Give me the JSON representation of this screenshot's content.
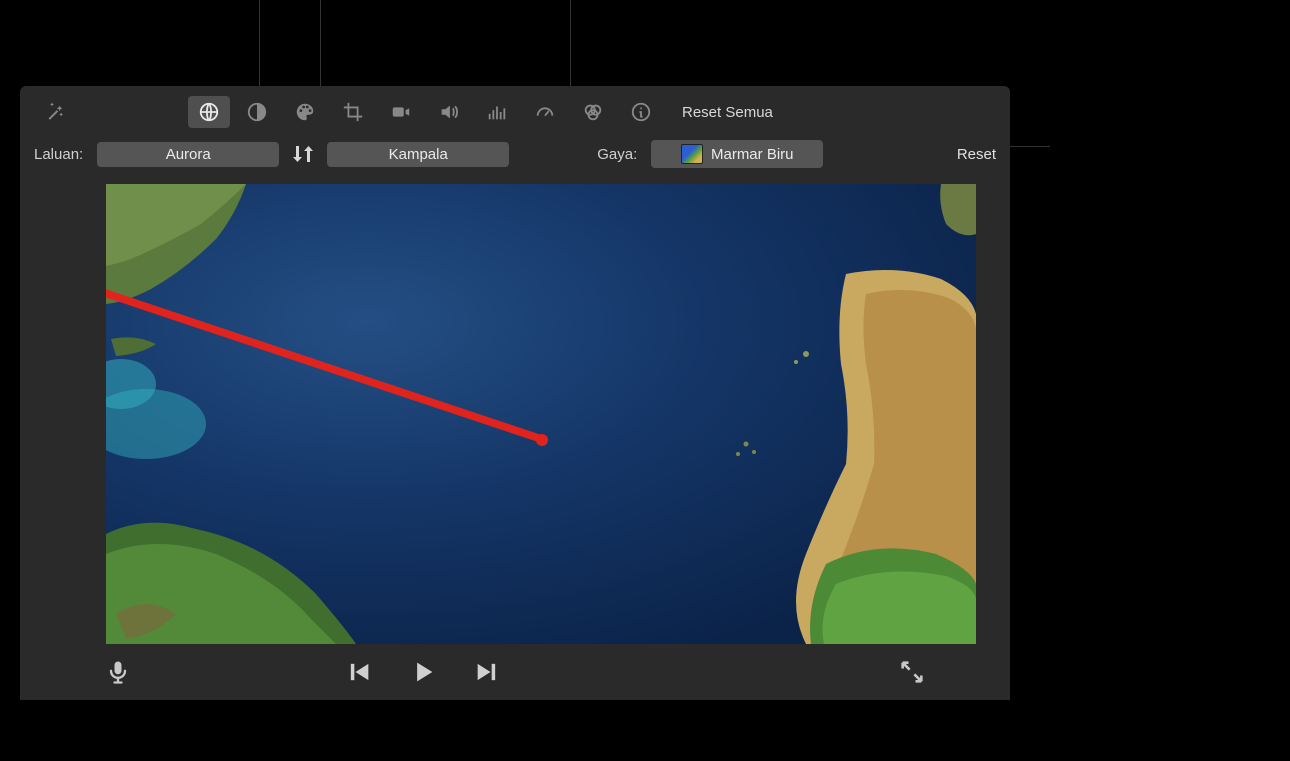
{
  "toolbar": {
    "reset_all": "Reset Semua"
  },
  "controls": {
    "route_label": "Laluan:",
    "start_city": "Aurora",
    "end_city": "Kampala",
    "style_label": "Gaya:",
    "style_value": "Marmar Biru",
    "reset": "Reset"
  }
}
